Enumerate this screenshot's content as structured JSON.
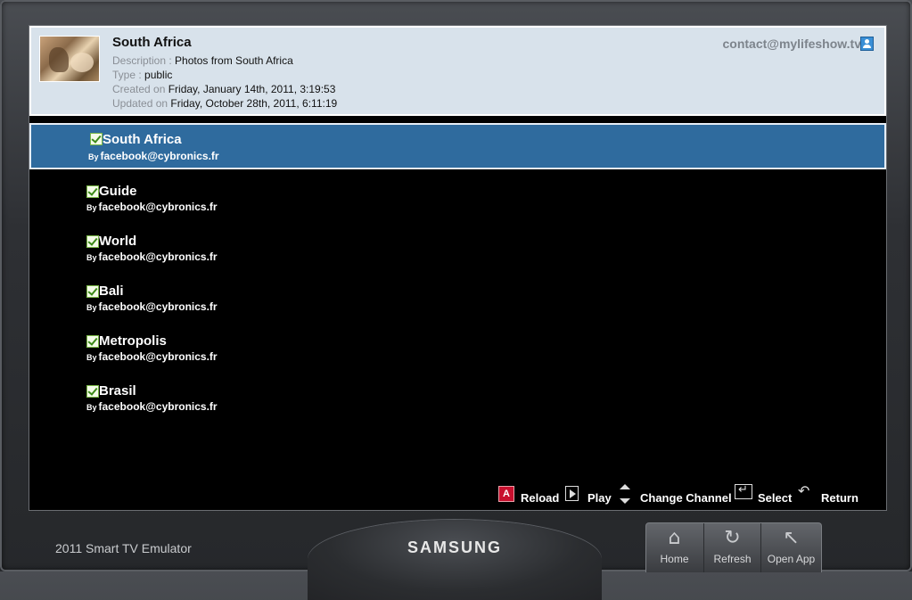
{
  "album": {
    "title": "South Africa",
    "description_label": "Description : ",
    "description": "Photos from South Africa",
    "type_label": "Type : ",
    "type": "public",
    "created_label": "Created on ",
    "created": "Friday, January 14th, 2011, 3:19:53",
    "updated_label": "Updated on ",
    "updated": "Friday, October 28th, 2011, 6:11:19",
    "contact": "contact@mylifeshow.tv"
  },
  "items": [
    {
      "title": "South Africa",
      "by_label": "By",
      "owner": "facebook@cybronics.fr",
      "selected": true
    },
    {
      "title": "Guide",
      "by_label": "By",
      "owner": "facebook@cybronics.fr",
      "selected": false
    },
    {
      "title": "World",
      "by_label": "By",
      "owner": "facebook@cybronics.fr",
      "selected": false
    },
    {
      "title": "Bali",
      "by_label": "By",
      "owner": "facebook@cybronics.fr",
      "selected": false
    },
    {
      "title": "Metropolis",
      "by_label": "By",
      "owner": "facebook@cybronics.fr",
      "selected": false
    },
    {
      "title": "Brasil",
      "by_label": "By",
      "owner": "facebook@cybronics.fr",
      "selected": false
    }
  ],
  "footer": {
    "a_key": "A",
    "reload": "Reload",
    "play": "Play",
    "change_channel": "Change Channel",
    "select": "Select",
    "return": "Return"
  },
  "emulator": {
    "label": "2011 Smart TV Emulator",
    "brand": "SAMSUNG",
    "buttons": [
      {
        "label": "Home",
        "icon": "home-icon"
      },
      {
        "label": "Refresh",
        "icon": "refresh-icon"
      },
      {
        "label": "Open App",
        "icon": "open-app-icon"
      }
    ]
  },
  "colors": {
    "selection": "#2f6b9e",
    "header_bg": "#d8e2eb",
    "red_key": "#c8102e"
  }
}
